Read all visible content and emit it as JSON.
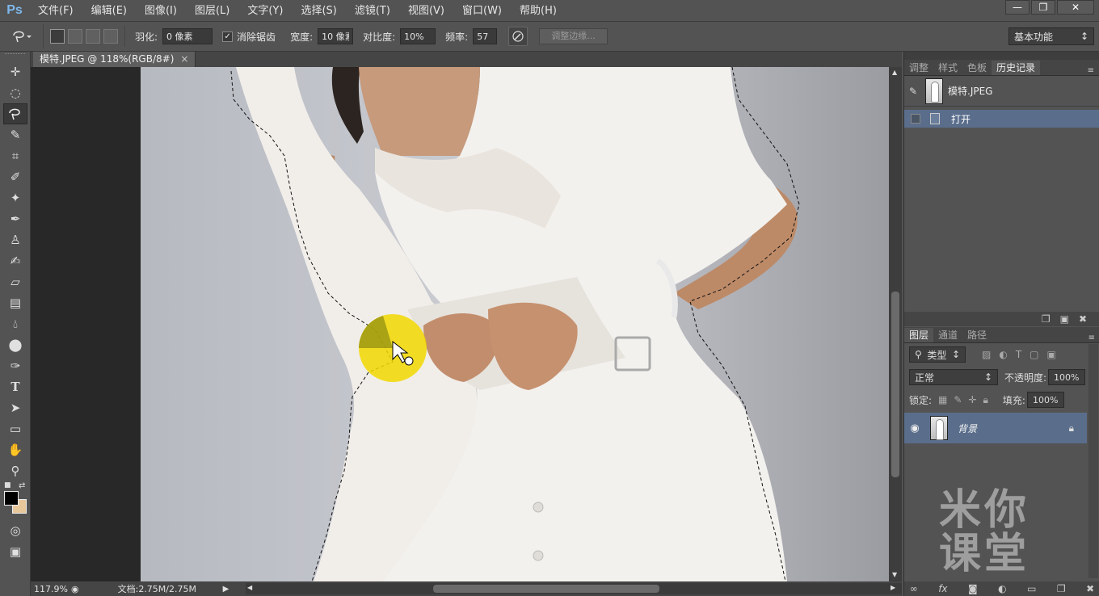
{
  "app": {
    "logo": "Ps"
  },
  "menu": [
    "文件(F)",
    "编辑(E)",
    "图像(I)",
    "图层(L)",
    "文字(Y)",
    "选择(S)",
    "滤镜(T)",
    "视图(V)",
    "窗口(W)",
    "帮助(H)"
  ],
  "options": {
    "feather_label": "羽化:",
    "feather_value": "0 像素",
    "antialias_label": "消除锯齿",
    "width_label": "宽度:",
    "width_value": "10 像素",
    "contrast_label": "对比度:",
    "contrast_value": "10%",
    "frequency_label": "频率:",
    "frequency_value": "57",
    "refine_edge": "调整边缘...",
    "workspace": "基本功能"
  },
  "document": {
    "tab_title": "模特.JPEG @ 118%(RGB/8#)",
    "zoom": "117.9%",
    "doc_info": "文档:2.75M/2.75M"
  },
  "history_panel": {
    "tabs": [
      "调整",
      "样式",
      "色板",
      "历史记录"
    ],
    "active_tab": 3,
    "snapshot_name": "模特.JPEG",
    "states": [
      "打开"
    ]
  },
  "layers_panel": {
    "tabs": [
      "图层",
      "通道",
      "路径"
    ],
    "active_tab": 0,
    "filter_kind": "类型",
    "blend_mode": "正常",
    "opacity_label": "不透明度:",
    "opacity_value": "100%",
    "lock_label": "锁定:",
    "fill_label": "填充:",
    "fill_value": "100%",
    "layers": [
      "背景"
    ]
  },
  "watermark": {
    "line1": "米你",
    "line2": "课堂"
  },
  "colors": {
    "accent": "#5a6e8c",
    "highlight": "#f2d800"
  }
}
